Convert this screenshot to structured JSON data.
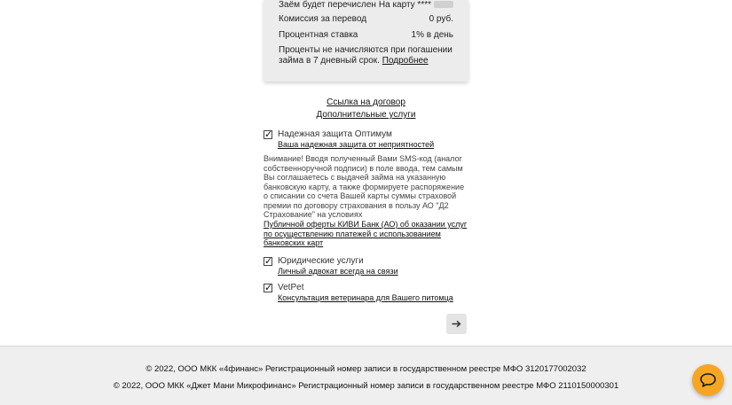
{
  "summary": {
    "transfer_label": "Заём будет перечислен",
    "transfer_value": "На карту ****",
    "commission_label": "Комиссия за перевод",
    "commission_value": "0 руб.",
    "rate_label": "Процентная ставка",
    "rate_value": "1% в день",
    "note_text": "Проценты не начисляются при погашении займа в 7 дневный срок. ",
    "note_link": "Подробнее"
  },
  "links": {
    "contract": "Ссылка на договор",
    "extra_services": "Дополнительные услуги"
  },
  "options": [
    {
      "title": "Надежная защита Оптимум",
      "subtitle": "Ваша надежная защита от неприятностей",
      "checked": true
    },
    {
      "title": "Юридические услуги",
      "subtitle": "Личный адвокат всегда на связи",
      "checked": true
    },
    {
      "title": "VetPet",
      "subtitle": "Консультация ветеринара для Вашего питомца",
      "checked": true
    }
  ],
  "checkmark": "✓",
  "warning_text": "Внимание! Вводя полученный Вами SMS-код (аналог собственноручной подписи) в поле ввода, тем самым Вы соглашаетесь с выдачей займа на указанную банковскую карту, а также формируете распоряжение о списании со счета Вашей карты суммы страховой премии по договору страхования в пользу АО \"Д2 Страхование\" на условиях",
  "offer_link": "Публичной оферты КИВИ Банк (АО) об оказании услуг по осуществлению платежей с использованием банковских карт",
  "next_button_icon": "arrow-right-icon",
  "footer": {
    "line1": "© 2022, ООО МКК «4финанс» Регистрационный номер записи в государственном реестре МФО 3120177002032",
    "line2": "© 2022, ООО МКК «Джет Мани Микрофинанс» Регистрационный номер записи в государственном реестре МФО 2110150000301"
  },
  "chat_button_icon": "chat-bubble-icon",
  "colors": {
    "accent_chat": "#f5a623",
    "card_bg": "#ececec",
    "footer_bg": "#efefef"
  }
}
